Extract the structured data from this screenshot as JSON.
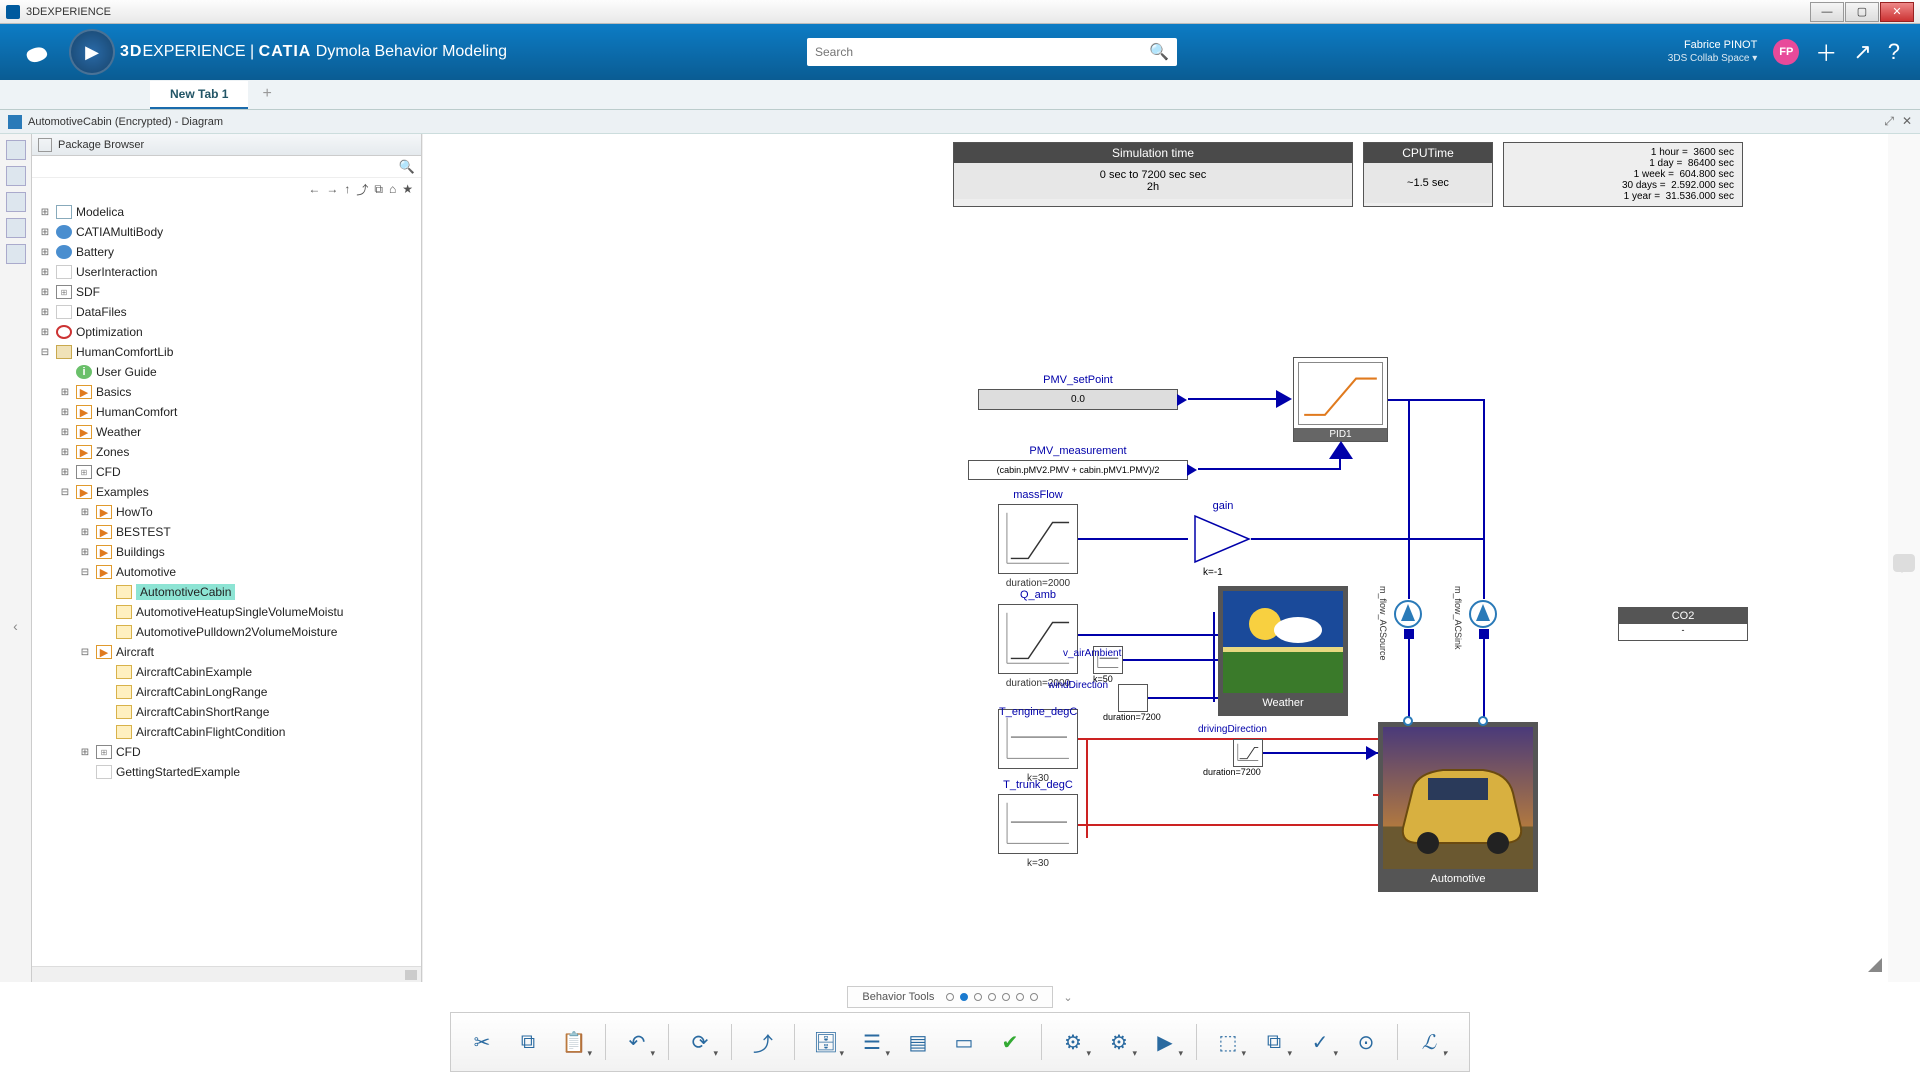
{
  "window": {
    "title": "3DEXPERIENCE"
  },
  "brand": {
    "prefix": "3D",
    "experience": "EXPERIENCE",
    "divider": " | ",
    "product": "CATIA",
    "module": " Dymola Behavior Modeling"
  },
  "search": {
    "placeholder": "Search"
  },
  "user": {
    "name": "Fabrice PINOT",
    "space": "3DS Collab Space ▾",
    "initials": "FP"
  },
  "tabs": {
    "main": "New Tab 1"
  },
  "subtab": {
    "title": "AutomotiveCabin (Encrypted) - Diagram"
  },
  "pkg": {
    "title": "Package Browser",
    "toolbar_glyphs": [
      "←",
      "→",
      "↑",
      "⤴",
      "⧉",
      "⌂",
      "★"
    ],
    "tree": [
      {
        "d": 0,
        "t": "plus",
        "i": "wave",
        "l": "Modelica"
      },
      {
        "d": 0,
        "t": "plus",
        "i": "gear",
        "l": "CATIAMultiBody"
      },
      {
        "d": 0,
        "t": "plus",
        "i": "gear",
        "l": "Battery"
      },
      {
        "d": 0,
        "t": "plus",
        "i": "text",
        "l": "UserInteraction"
      },
      {
        "d": 0,
        "t": "plus",
        "i": "grid",
        "l": "SDF"
      },
      {
        "d": 0,
        "t": "plus",
        "i": "text",
        "l": "DataFiles"
      },
      {
        "d": 0,
        "t": "plus",
        "i": "target",
        "l": "Optimization"
      },
      {
        "d": 0,
        "t": "minus",
        "i": "pkg",
        "l": "HumanComfortLib"
      },
      {
        "d": 1,
        "t": "none",
        "i": "info",
        "l": "User Guide"
      },
      {
        "d": 1,
        "t": "plus",
        "i": "play",
        "l": "Basics"
      },
      {
        "d": 1,
        "t": "plus",
        "i": "play",
        "l": "HumanComfort"
      },
      {
        "d": 1,
        "t": "plus",
        "i": "play",
        "l": "Weather"
      },
      {
        "d": 1,
        "t": "plus",
        "i": "play",
        "l": "Zones"
      },
      {
        "d": 1,
        "t": "plus",
        "i": "grid",
        "l": "CFD"
      },
      {
        "d": 1,
        "t": "minus",
        "i": "play",
        "l": "Examples"
      },
      {
        "d": 2,
        "t": "plus",
        "i": "play",
        "l": "HowTo"
      },
      {
        "d": 2,
        "t": "plus",
        "i": "play",
        "l": "BESTEST"
      },
      {
        "d": 2,
        "t": "plus",
        "i": "play",
        "l": "Buildings"
      },
      {
        "d": 2,
        "t": "minus",
        "i": "play",
        "l": "Automotive"
      },
      {
        "d": 3,
        "t": "none",
        "i": "folder",
        "l": "AutomotiveCabin",
        "sel": true
      },
      {
        "d": 3,
        "t": "none",
        "i": "folder",
        "l": "AutomotiveHeatupSingleVolumeMoistu"
      },
      {
        "d": 3,
        "t": "none",
        "i": "folder",
        "l": "AutomotivePulldown2VolumeMoisture"
      },
      {
        "d": 2,
        "t": "minus",
        "i": "play",
        "l": "Aircraft"
      },
      {
        "d": 3,
        "t": "none",
        "i": "folder",
        "l": "AircraftCabinExample"
      },
      {
        "d": 3,
        "t": "none",
        "i": "folder",
        "l": "AircraftCabinLongRange"
      },
      {
        "d": 3,
        "t": "none",
        "i": "folder",
        "l": "AircraftCabinShortRange"
      },
      {
        "d": 3,
        "t": "none",
        "i": "folder",
        "l": "AircraftCabinFlightCondition"
      },
      {
        "d": 2,
        "t": "plus",
        "i": "grid",
        "l": "CFD"
      },
      {
        "d": 2,
        "t": "none",
        "i": "text",
        "l": "GettingStartedExample"
      }
    ]
  },
  "info": {
    "sim_title": "Simulation time",
    "sim_range": "0 sec to 7200 sec sec",
    "sim_h": "2h",
    "cpu_title": "CPUTime",
    "cpu_val": "~1.5 sec",
    "conv": [
      "1 hour =  3600 sec",
      "1 day =  86400 sec",
      "1 week =  604.800 sec",
      "30 days =  2.592.000 sec",
      "1 year =  31.536.000 sec"
    ]
  },
  "diagram": {
    "pmv_set": "PMV_setPoint",
    "pmv_set_val": "0.0",
    "pmv_meas": "PMV_measurement",
    "pmv_meas_val": "(cabin.pMV2.PMV + cabin.pMV1.PMV)/2",
    "massflow": "massFlow",
    "massflow_sub": "duration=2000",
    "gain": "gain",
    "gain_sub": "k=-1",
    "pid": "PID1",
    "qamb": "Q_amb",
    "qamb_sub": "duration=2000",
    "vair": "v_airAmbient",
    "vair_sub": "k=50",
    "wind": "windDirection",
    "wind_sub": "duration=7200",
    "tengine": "T_engine_degC",
    "tengine_sub": "k=30",
    "ttrunk": "T_trunk_degC",
    "ttrunk_sub": "k=30",
    "driving": "drivingDirection",
    "driving_sub": "duration=7200",
    "weather": "Weather",
    "auto": "Automotive",
    "pump1": "m_flow_ACSource",
    "pump2": "m_flow_ACSink",
    "co2": "CO2",
    "co2_val": "-"
  },
  "bottom": {
    "tab": "Behavior Tools"
  }
}
